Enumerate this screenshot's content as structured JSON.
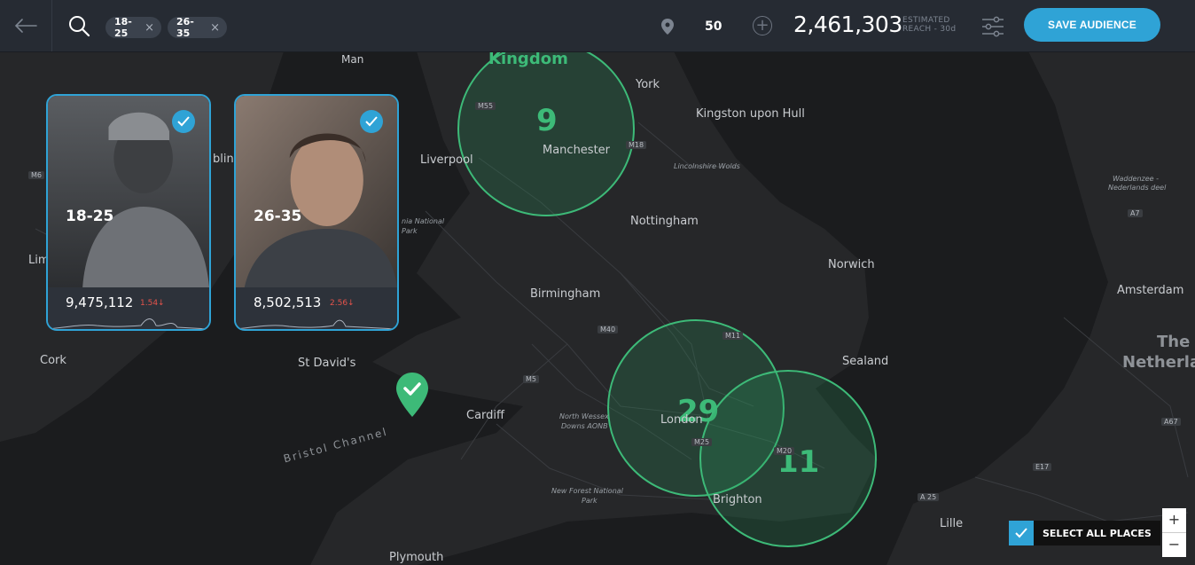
{
  "topbar": {
    "chips": [
      {
        "label": "18-25"
      },
      {
        "label": "26-35"
      }
    ],
    "chip_remove": "×",
    "radius": "50",
    "reach_value": "2,461,303",
    "reach_label_1": "ESTIMATED",
    "reach_label_2": "REACH - 30d",
    "save_label": "SAVE AUDIENCE"
  },
  "cards": [
    {
      "age": "18-25",
      "count": "9,475,112",
      "change": "1.54↓"
    },
    {
      "age": "26-35",
      "count": "8,502,513",
      "change": "2.56↓"
    }
  ],
  "circles": [
    {
      "count": "9"
    },
    {
      "count": "29"
    },
    {
      "count": "11"
    }
  ],
  "map_labels": {
    "kingdom": "Kingdom",
    "man": "Man",
    "york": "York",
    "hull": "Kingston upon Hull",
    "m55": "M55",
    "m18": "M18",
    "manchester": "Manchester",
    "liverpool": "Liverpool",
    "lincs": "Lincolnshire Wolds",
    "m6": "M6",
    "dublin_frag": "blin",
    "snowdonia_1": "nia National",
    "snowdonia_2": "Park",
    "nottingham": "Nottingham",
    "norwich": "Norwich",
    "birmingham": "Birmingham",
    "lim": "Lim",
    "m40": "M40",
    "m11": "M11",
    "cork": "Cork",
    "st_davids": "St David's",
    "sealand": "Sealand",
    "m5": "M5",
    "cardiff": "Cardiff",
    "north_wessex_1": "North Wessex",
    "north_wessex_2": "Downs AONB",
    "london": "London",
    "m25": "M25",
    "m20": "M20",
    "bristol_channel": "Bristol Channel",
    "new_forest_1": "New Forest National",
    "new_forest_2": "Park",
    "brighton": "Brighton",
    "plymouth": "Plymouth",
    "wadden_1": "Waddenzee -",
    "wadden_2": "Nederlands deel",
    "a7": "A7",
    "amsterdam": "Amsterdam",
    "the": "The",
    "netherlands": "Netherlan",
    "a67": "A67",
    "e17": "E17",
    "a25": "A 25",
    "lille": "Lille"
  },
  "select_all": "SELECT ALL PLACES",
  "zoom": {
    "in": "+",
    "out": "−"
  },
  "colors": {
    "accent": "#2fa3d6",
    "circle": "#3dba78",
    "decline": "#e5534b"
  }
}
